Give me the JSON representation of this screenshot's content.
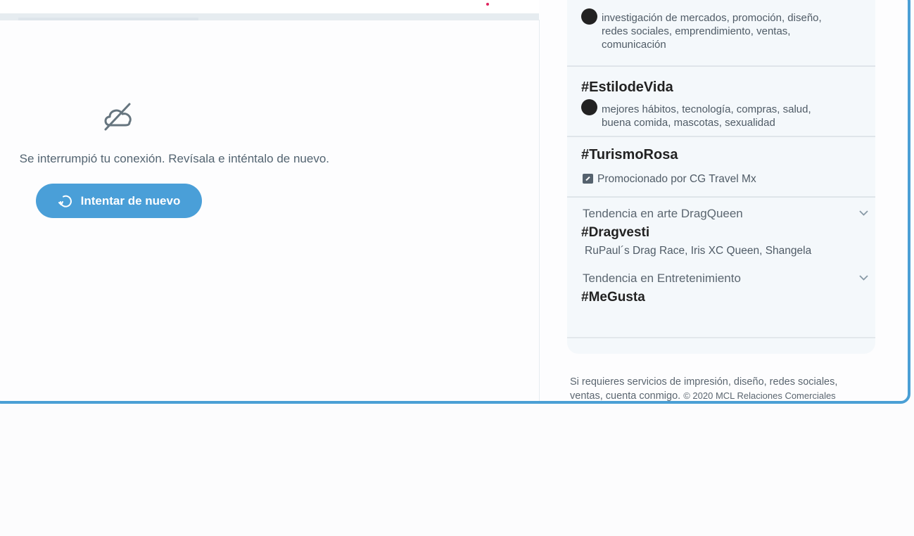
{
  "main": {
    "error_message": "Se interrumpió tu conexión. Revísala e inténtalo de nuevo.",
    "retry_label": "Intentar de nuevo"
  },
  "trends": {
    "items": [
      {
        "type": "topic",
        "desc_lines": [
          "investigación de mercados, promoción, diseño,",
          "redes sociales, emprendimiento, ventas,",
          "comunicación"
        ]
      },
      {
        "type": "topic",
        "title": "#EstilodeVida",
        "desc_lines": [
          "mejores hábitos, tecnología, compras, salud,",
          "buena comida, mascotas, sexualidad"
        ]
      },
      {
        "type": "promoted",
        "title": "#TurismoRosa",
        "promoted_text": "Promocionado por CG Travel Mx"
      },
      {
        "type": "trend",
        "context": "Tendencia en arte DragQueen",
        "title": "#Dragvesti",
        "desc": "RuPaul´s Drag Race, Iris XC Queen, Shangela"
      },
      {
        "type": "trend",
        "context": "Tendencia en Entretenimiento",
        "title": "#MeGusta"
      }
    ]
  },
  "footer": {
    "line1": "Si requieres servicios de impresión, diseño, redes sociales,",
    "line2_text": "ventas, cuenta conmigo.",
    "copyright": "© 2020 MCL Relaciones Comerciales"
  },
  "colors": {
    "accent": "#4a9fd8",
    "frame": "#4a9fd5",
    "trends_bg": "#f4f8fb"
  },
  "icons": [
    "disconnected-cloud-icon",
    "refresh-icon",
    "bullet-dot-icon",
    "promoted-icon",
    "chevron-down-icon"
  ]
}
